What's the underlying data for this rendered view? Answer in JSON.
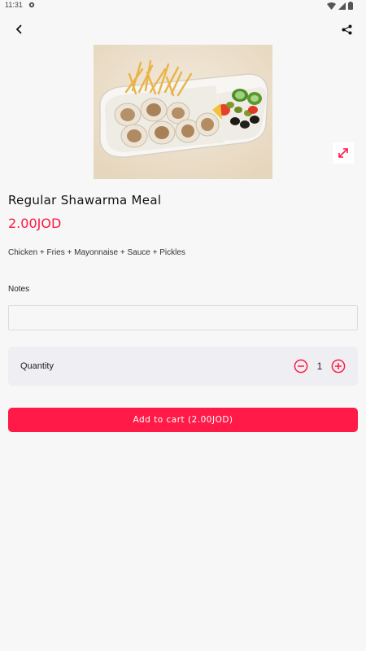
{
  "status_bar": {
    "time": "11:31",
    "icons": [
      "settings-icon",
      "wifi-icon",
      "cellular-icon",
      "battery-icon"
    ]
  },
  "topbar": {
    "back_icon": "chevron-left-icon",
    "share_icon": "share-icon"
  },
  "product": {
    "image_alt": "shawarma-meal-photo",
    "title": "Regular Shawarma Meal",
    "price": "2.00JOD",
    "description": "Chicken + Fries + Mayonnaise + Sauce + Pickles"
  },
  "notes": {
    "label": "Notes",
    "value": "",
    "placeholder": ""
  },
  "quantity": {
    "label": "Quantity",
    "value": "1"
  },
  "add_to_cart": {
    "label": "Add to cart (2.00JOD)"
  },
  "colors": {
    "accent": "#ff1a47",
    "price": "#ff1744",
    "background": "#f7f7f7"
  }
}
